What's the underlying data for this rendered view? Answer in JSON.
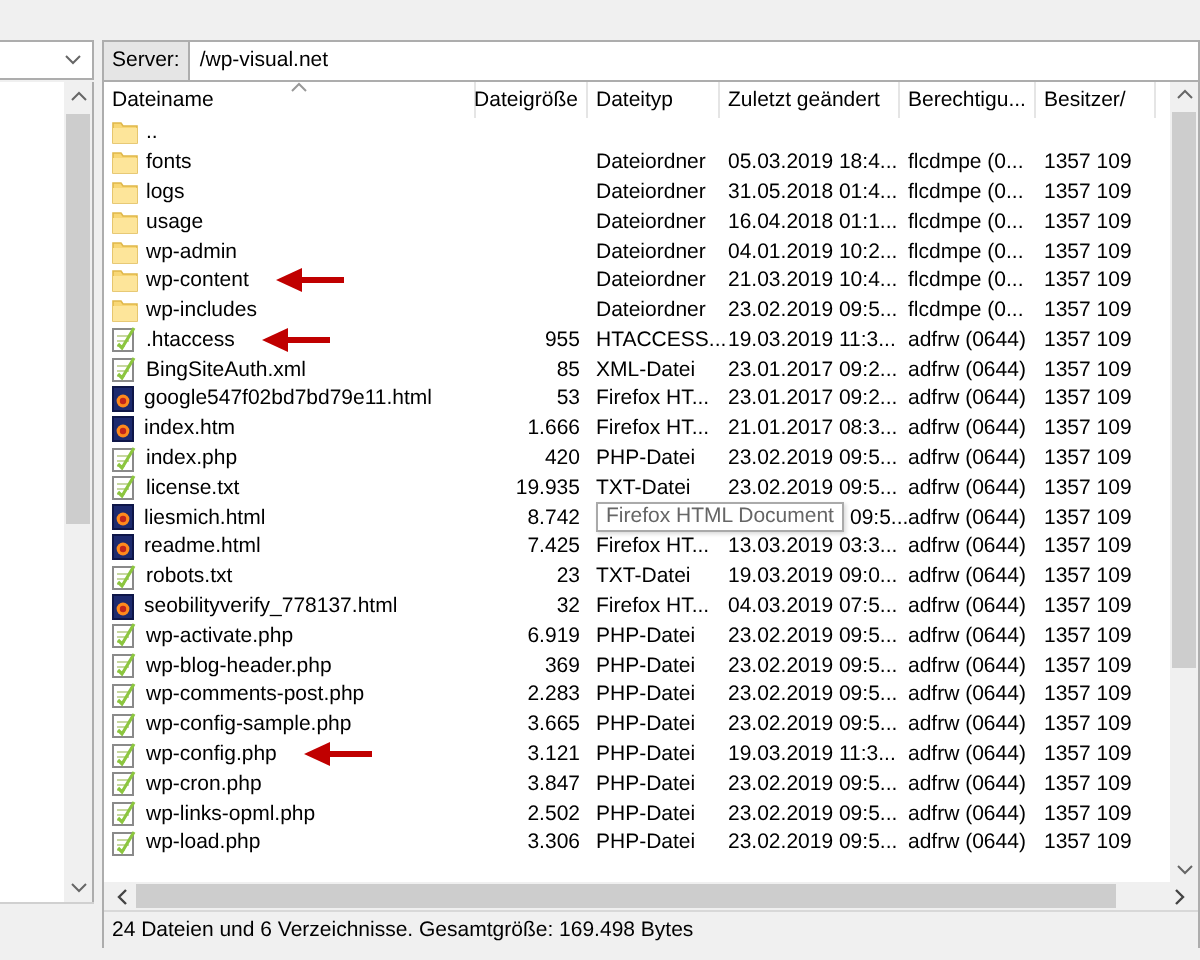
{
  "server": {
    "label": "Server:",
    "path": "/wp-visual.net"
  },
  "columns": [
    {
      "label": "Dateiname",
      "sorted": true
    },
    {
      "label": "Dateigröße",
      "sorted": false
    },
    {
      "label": "Dateityp",
      "sorted": false
    },
    {
      "label": "Zuletzt geändert",
      "sorted": false
    },
    {
      "label": "Berechtigu...",
      "sorted": false
    },
    {
      "label": "Besitzer/",
      "sorted": false
    }
  ],
  "rows": [
    {
      "kind": "folder",
      "name": "..",
      "marked": false
    },
    {
      "kind": "folder",
      "name": "fonts",
      "type": "Dateiordner",
      "modified": "05.03.2019 18:4...",
      "permissions": "flcdmpe (0...",
      "owner": "1357 109",
      "marked": false
    },
    {
      "kind": "folder",
      "name": "logs",
      "type": "Dateiordner",
      "modified": "31.05.2018 01:4...",
      "permissions": "flcdmpe (0...",
      "owner": "1357 109",
      "marked": false
    },
    {
      "kind": "folder",
      "name": "usage",
      "type": "Dateiordner",
      "modified": "16.04.2018 01:1...",
      "permissions": "flcdmpe (0...",
      "owner": "1357 109",
      "marked": false
    },
    {
      "kind": "folder",
      "name": "wp-admin",
      "type": "Dateiordner",
      "modified": "04.01.2019 10:2...",
      "permissions": "flcdmpe (0...",
      "owner": "1357 109",
      "marked": false
    },
    {
      "kind": "folder",
      "name": "wp-content",
      "type": "Dateiordner",
      "modified": "21.03.2019 10:4...",
      "permissions": "flcdmpe (0...",
      "owner": "1357 109",
      "marked": true
    },
    {
      "kind": "folder",
      "name": "wp-includes",
      "type": "Dateiordner",
      "modified": "23.02.2019 09:5...",
      "permissions": "flcdmpe (0...",
      "owner": "1357 109",
      "marked": false
    },
    {
      "kind": "text",
      "name": ".htaccess",
      "size": "955",
      "type": "HTACCESS...",
      "modified": "19.03.2019 11:3...",
      "permissions": "adfrw (0644)",
      "owner": "1357 109",
      "marked": true
    },
    {
      "kind": "text",
      "name": "BingSiteAuth.xml",
      "size": "85",
      "type": "XML-Datei",
      "modified": "23.01.2017 09:2...",
      "permissions": "adfrw (0644)",
      "owner": "1357 109",
      "marked": false
    },
    {
      "kind": "html",
      "name": "google547f02bd7bd79e11.html",
      "size": "53",
      "type": "Firefox HT...",
      "modified": "23.01.2017 09:2...",
      "permissions": "adfrw (0644)",
      "owner": "1357 109",
      "marked": false
    },
    {
      "kind": "html",
      "name": "index.htm",
      "size": "1.666",
      "type": "Firefox HT...",
      "modified": "21.01.2017 08:3...",
      "permissions": "adfrw (0644)",
      "owner": "1357 109",
      "marked": false
    },
    {
      "kind": "text",
      "name": "index.php",
      "size": "420",
      "type": "PHP-Datei",
      "modified": "23.02.2019 09:5...",
      "permissions": "adfrw (0644)",
      "owner": "1357 109",
      "marked": false
    },
    {
      "kind": "text",
      "name": "license.txt",
      "size": "19.935",
      "type": "TXT-Datei",
      "modified": "23.02.2019 09:5...",
      "permissions": "adfrw (0644)",
      "owner": "1357 109",
      "marked": false
    },
    {
      "kind": "html",
      "name": "liesmich.html",
      "size": "8.742",
      "tooltip": "Firefox HTML Document",
      "modified": "09:5...",
      "permissions": "adfrw (0644)",
      "owner": "1357 109",
      "marked": false
    },
    {
      "kind": "html",
      "name": "readme.html",
      "size": "7.425",
      "type": "Firefox HT...",
      "modified": "13.03.2019 03:3...",
      "permissions": "adfrw (0644)",
      "owner": "1357 109",
      "marked": false
    },
    {
      "kind": "text",
      "name": "robots.txt",
      "size": "23",
      "type": "TXT-Datei",
      "modified": "19.03.2019 09:0...",
      "permissions": "adfrw (0644)",
      "owner": "1357 109",
      "marked": false
    },
    {
      "kind": "html",
      "name": "seobilityverify_778137.html",
      "size": "32",
      "type": "Firefox HT...",
      "modified": "04.03.2019 07:5...",
      "permissions": "adfrw (0644)",
      "owner": "1357 109",
      "marked": false
    },
    {
      "kind": "text",
      "name": "wp-activate.php",
      "size": "6.919",
      "type": "PHP-Datei",
      "modified": "23.02.2019 09:5...",
      "permissions": "adfrw (0644)",
      "owner": "1357 109",
      "marked": false
    },
    {
      "kind": "text",
      "name": "wp-blog-header.php",
      "size": "369",
      "type": "PHP-Datei",
      "modified": "23.02.2019 09:5...",
      "permissions": "adfrw (0644)",
      "owner": "1357 109",
      "marked": false
    },
    {
      "kind": "text",
      "name": "wp-comments-post.php",
      "size": "2.283",
      "type": "PHP-Datei",
      "modified": "23.02.2019 09:5...",
      "permissions": "adfrw (0644)",
      "owner": "1357 109",
      "marked": false
    },
    {
      "kind": "text",
      "name": "wp-config-sample.php",
      "size": "3.665",
      "type": "PHP-Datei",
      "modified": "23.02.2019 09:5...",
      "permissions": "adfrw (0644)",
      "owner": "1357 109",
      "marked": false
    },
    {
      "kind": "text",
      "name": "wp-config.php",
      "size": "3.121",
      "type": "PHP-Datei",
      "modified": "19.03.2019 11:3...",
      "permissions": "adfrw (0644)",
      "owner": "1357 109",
      "marked": true
    },
    {
      "kind": "text",
      "name": "wp-cron.php",
      "size": "3.847",
      "type": "PHP-Datei",
      "modified": "23.02.2019 09:5...",
      "permissions": "adfrw (0644)",
      "owner": "1357 109",
      "marked": false
    },
    {
      "kind": "text",
      "name": "wp-links-opml.php",
      "size": "2.502",
      "type": "PHP-Datei",
      "modified": "23.02.2019 09:5...",
      "permissions": "adfrw (0644)",
      "owner": "1357 109",
      "marked": false
    },
    {
      "kind": "text",
      "name": "wp-load.php",
      "size": "3.306",
      "type": "PHP-Datei",
      "modified": "23.02.2019 09:5...",
      "permissions": "adfrw (0644)",
      "owner": "1357 109",
      "marked": false
    }
  ],
  "status_bar": "24 Dateien und 6 Verzeichnisse. Gesamtgröße: 169.498 Bytes"
}
